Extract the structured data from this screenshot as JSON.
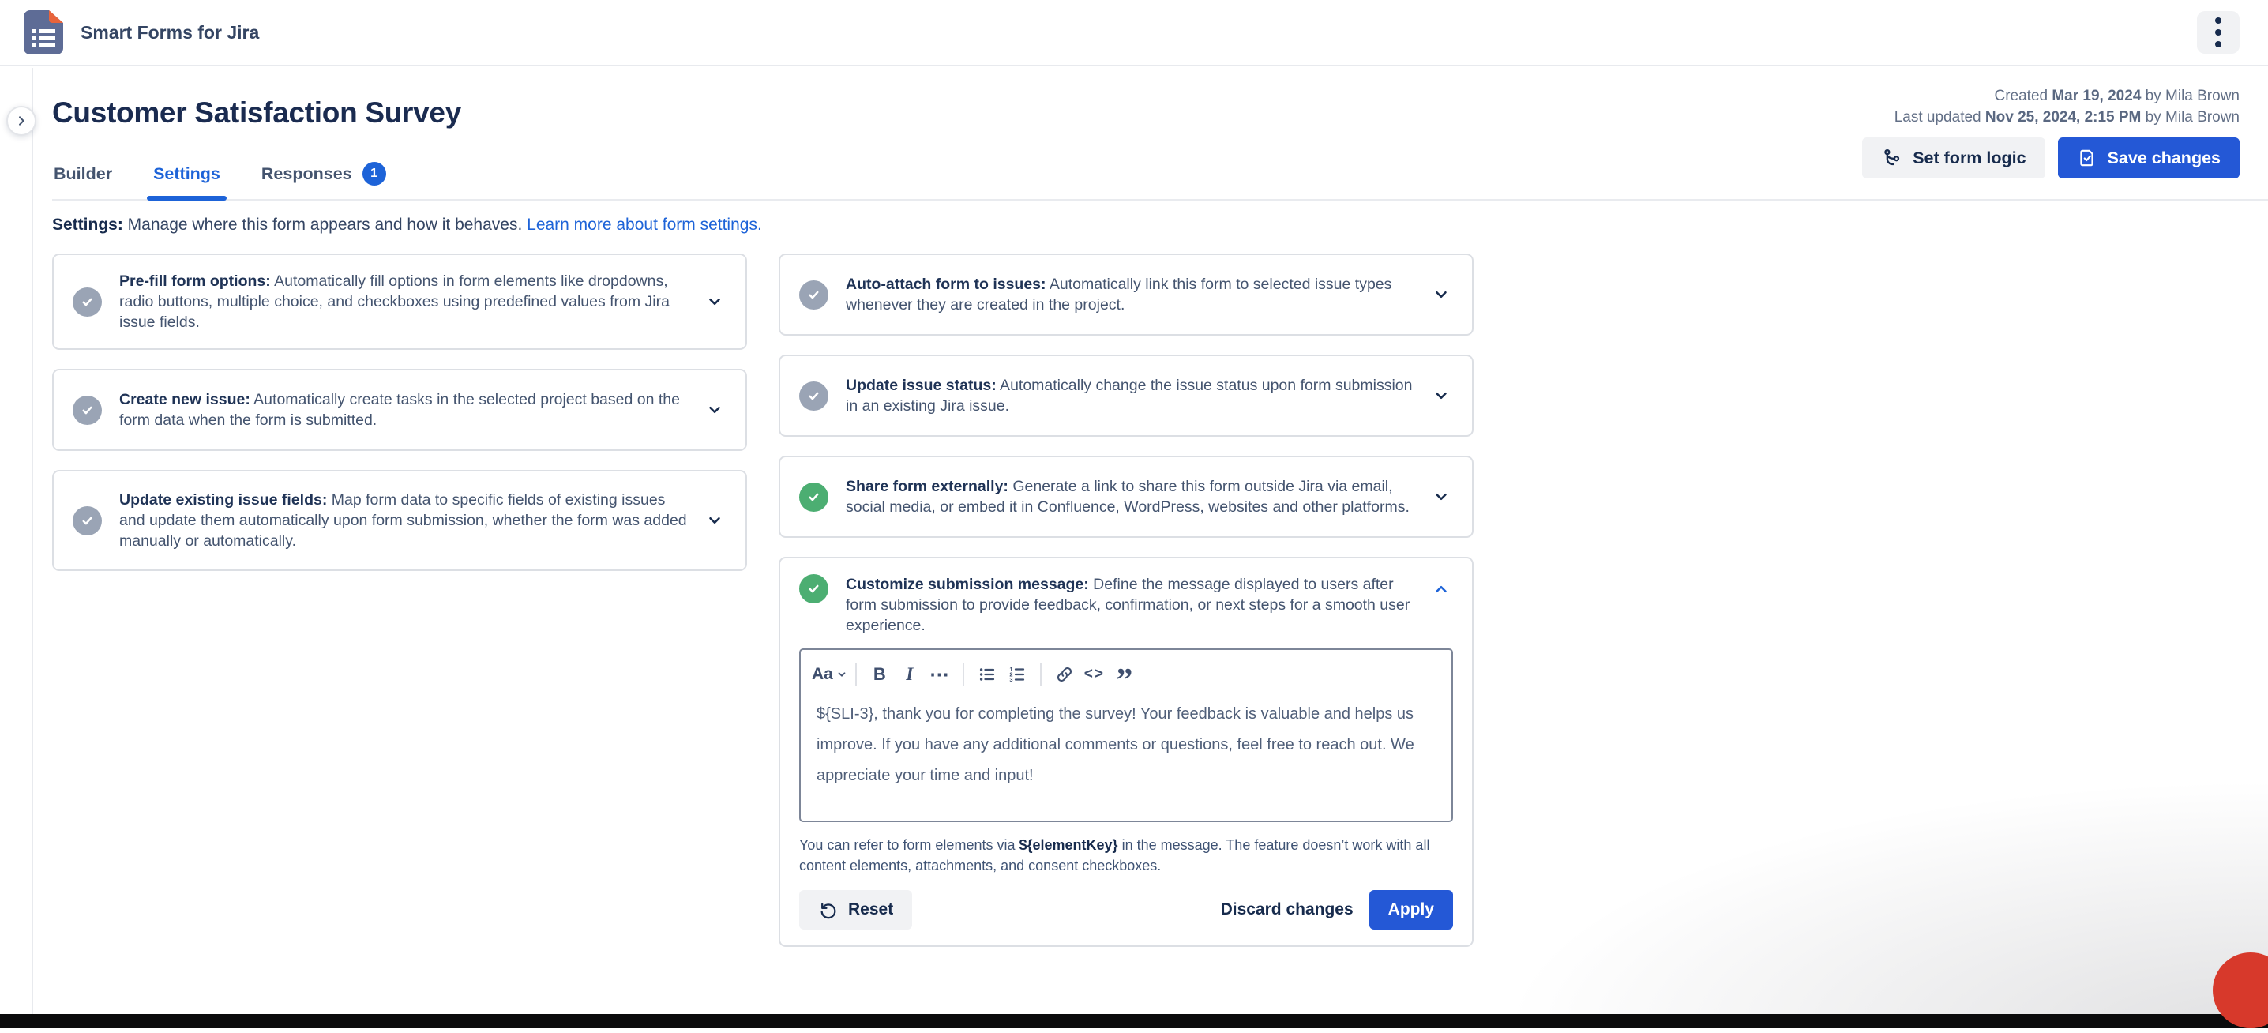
{
  "topbar": {
    "app_title": "Smart Forms for Jira"
  },
  "page": {
    "title": "Customer Satisfaction Survey",
    "created": {
      "pre": "Created ",
      "date": "Mar 19, 2024",
      "post": " by Mila Brown"
    },
    "updated": {
      "pre": "Last updated ",
      "date": "Nov 25, 2024, 2:15 PM",
      "post": " by Mila Brown"
    }
  },
  "tabs": [
    {
      "label": "Builder"
    },
    {
      "label": "Settings"
    },
    {
      "label": "Responses",
      "badge": "1"
    }
  ],
  "actions": {
    "set_form_logic": "Set form logic",
    "save_changes": "Save changes"
  },
  "settings_note": {
    "lead": "Settings:",
    "text": " Manage where this form appears and how it behaves. ",
    "link": "Learn more about form settings."
  },
  "cards": [
    {
      "title": "Pre-fill form options:",
      "description": " Automatically fill options in form elements like dropdowns, radio buttons, multiple choice, and checkboxes using predefined values from Jira issue fields.",
      "state": "off"
    },
    {
      "title": "Auto-attach form to issues:",
      "description": " Automatically link this form to selected issue types whenever they are created in the project.",
      "state": "off"
    },
    {
      "title": "Create new issue:",
      "description": " Automatically create tasks in the selected project based on the form data when the form is submitted.",
      "state": "off"
    },
    {
      "title": "Update issue status:",
      "description": " Automatically change the issue status upon form submission in an existing Jira issue.",
      "state": "off"
    },
    {
      "title": "Update existing issue fields:",
      "description": " Map form data to specific fields of existing issues and update them automatically upon form submission, whether the form was added manually or automatically.",
      "state": "off"
    },
    {
      "title": "Share form externally:",
      "description": " Generate a link to share this form outside Jira via email, social media, or embed it in Confluence, WordPress, websites and other platforms.",
      "state": "on"
    },
    {
      "title": "Customize submission message:",
      "description": " Define the message displayed to users after form submission to provide feedback, confirmation, or next steps for a smooth user experience.",
      "state": "on",
      "expanded": true
    }
  ],
  "editor": {
    "toolbar": {
      "text_style": "Aa",
      "bold": "B",
      "italic": "I",
      "more": "⋯",
      "code": "<>",
      "quote": "”"
    },
    "message": "${SLI-3}, thank you for completing the survey! Your feedback is valuable and helps us improve. If you have any additional comments or questions, feel free to reach out. We appreciate your time and input!",
    "note": {
      "pre": "You can refer to form elements via ",
      "key": "${elementKey}",
      "post": " in the message. The feature doesn’t work with all content elements, attachments, and consent checkboxes."
    },
    "buttons": {
      "reset": "Reset",
      "discard": "Discard changes",
      "apply": "Apply"
    }
  },
  "colors": {
    "accent_blue": "#2458D6",
    "link_blue": "#1D63D8",
    "success_green": "#4CAE72",
    "disabled_gray": "#9AA4B5",
    "record_red": "#D7392B"
  }
}
